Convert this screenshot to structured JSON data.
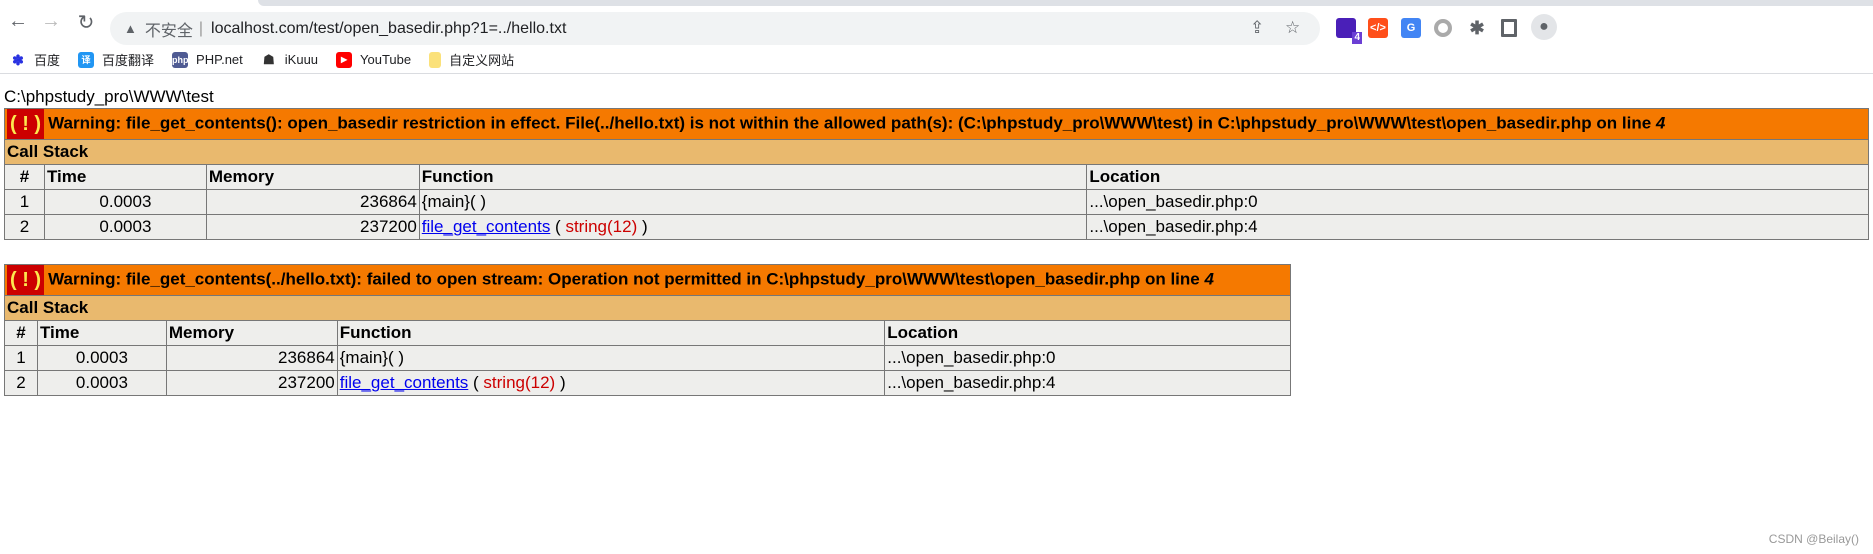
{
  "browser": {
    "address_insecure": "不安全",
    "url": "localhost.com/test/open_basedir.php?1=../hello.txt",
    "extension_badge": "4",
    "bookmarks": [
      "百度",
      "百度翻译",
      "PHP.net",
      "iKuuu",
      "YouTube",
      "自定义网站"
    ]
  },
  "page": {
    "path_output": "C:\\phpstudy_pro\\WWW\\test",
    "warnings": [
      {
        "icon": "( ! )",
        "message": "Warning: file_get_contents(): open_basedir restriction in effect. File(../hello.txt) is not within the allowed path(s): (C:\\phpstudy_pro\\WWW\\test) in C:\\phpstudy_pro\\WWW\\test\\open_basedir.php on line ",
        "line": "4",
        "call_stack_label": "Call Stack",
        "headers": [
          "#",
          "Time",
          "Memory",
          "Function",
          "Location"
        ],
        "rows": [
          {
            "n": "1",
            "time": "0.0003",
            "memory": "236864",
            "func": "{main}( )",
            "args": "",
            "location": "...\\open_basedir.php:0"
          },
          {
            "n": "2",
            "time": "0.0003",
            "memory": "237200",
            "func": "file_get_contents",
            "args": "string(12)",
            "location": "...\\open_basedir.php:4"
          }
        ]
      },
      {
        "icon": "( ! )",
        "message": "Warning: file_get_contents(../hello.txt): failed to open stream: Operation not permitted in C:\\phpstudy_pro\\WWW\\test\\open_basedir.php on line ",
        "line": "4",
        "call_stack_label": "Call Stack",
        "headers": [
          "#",
          "Time",
          "Memory",
          "Function",
          "Location"
        ],
        "rows": [
          {
            "n": "1",
            "time": "0.0003",
            "memory": "236864",
            "func": "{main}( )",
            "args": "",
            "location": "...\\open_basedir.php:0"
          },
          {
            "n": "2",
            "time": "0.0003",
            "memory": "237200",
            "func": "file_get_contents",
            "args": "string(12)",
            "location": "...\\open_basedir.php:4"
          }
        ]
      }
    ]
  },
  "watermark": "CSDN @Beilay()",
  "colors": {
    "warning_bg": "#f57900",
    "callstack_bg": "#e9b96e",
    "row_bg": "#eeeeec",
    "icon_bg": "#cc0000"
  }
}
